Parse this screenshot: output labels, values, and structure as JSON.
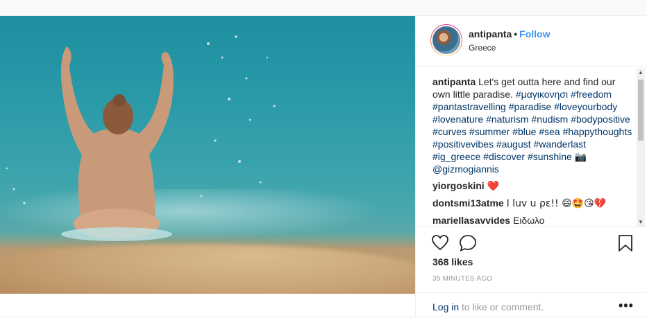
{
  "post": {
    "image_alt": "",
    "username": "antipanta",
    "follow_label": "Follow",
    "location": "Greece",
    "caption": {
      "username": "antipanta",
      "text_parts": [
        "Let's get outta here and find our own little paradise. ",
        "#μαγικονησι",
        " ",
        "#freedom",
        " ",
        "#pantastravelling",
        " ",
        "#paradise",
        " ",
        "#loveyourbody",
        " ",
        "#lovenature",
        " ",
        "#naturism",
        " ",
        "#nudism",
        " ",
        "#bodypositive",
        " ",
        "#curves",
        " ",
        "#summer",
        " ",
        "#blue",
        " ",
        "#sea",
        " ",
        "#happythoughts",
        " ",
        "#positivevibes",
        " ",
        "#august",
        " ",
        "#wanderlast",
        " ",
        "#ig_greece",
        " ",
        "#discover",
        " ",
        "#sunshine",
        " 📷 ",
        "@gizmogiannis"
      ]
    },
    "comments": [
      {
        "username": "yiorgoskini",
        "text": "❤️"
      },
      {
        "username": "dontsmi13atme",
        "text": "I luv u ρε!! 😄🤩😘💔"
      },
      {
        "username": "mariellasavvides",
        "text": "Ειδωλο"
      }
    ],
    "likes": "368 likes",
    "time": "35 MINUTES AGO",
    "login": {
      "link": "Log in",
      "rest": " to like or comment."
    },
    "more_label": "•••"
  },
  "icons": {
    "like": "heart-outline-icon",
    "comment": "speech-bubble-icon",
    "save": "bookmark-icon",
    "camera": "camera-emoji"
  },
  "colors": {
    "link": "#003569",
    "follow": "#3897f0",
    "text": "#262626",
    "muted": "#999999"
  }
}
